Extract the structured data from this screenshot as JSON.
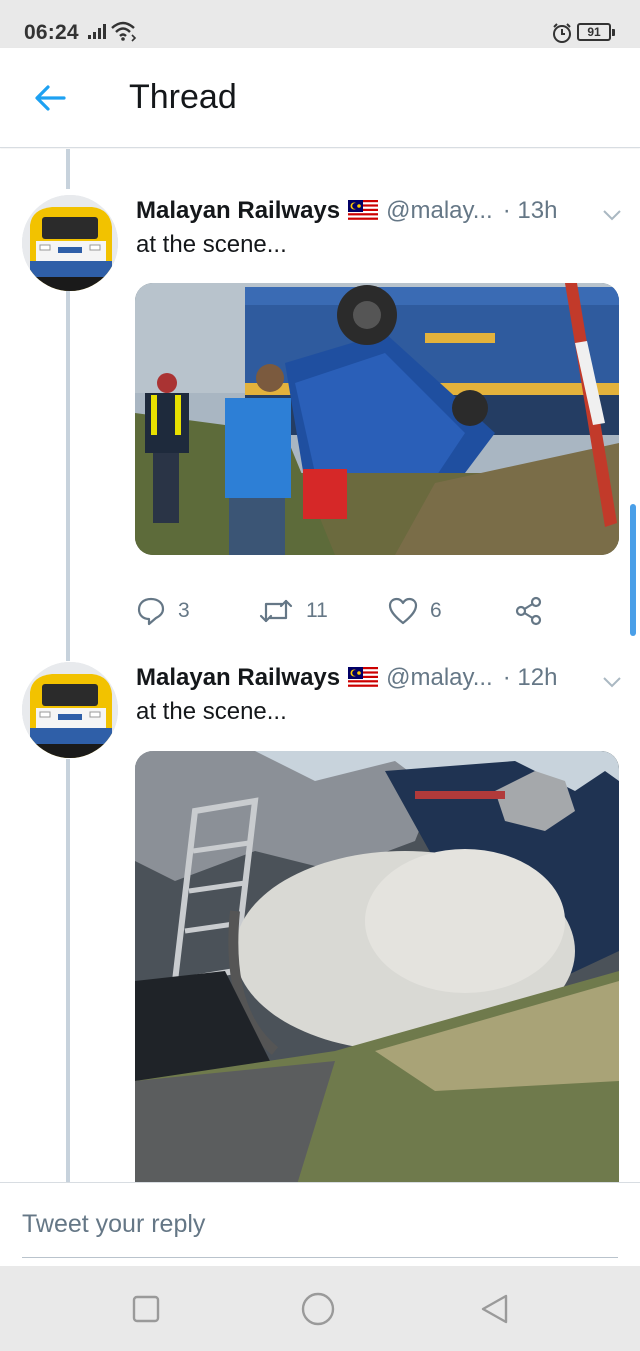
{
  "status_bar": {
    "time": "06:24",
    "battery": "91",
    "icons": [
      "signal-icon",
      "wifi-icon",
      "alarm-icon",
      "battery-icon"
    ]
  },
  "header": {
    "back_icon": "arrow-left-icon",
    "title": "Thread"
  },
  "colors": {
    "accent": "#1da1f2",
    "text_primary": "#14171a",
    "text_secondary": "#657786",
    "thread_line": "#c7d2dc",
    "system_bar": "#e9e9e9",
    "scrollbar": "#4a9fe8"
  },
  "tweets": [
    {
      "author": "Malayan Railways",
      "flag_icon": "malaysia-flag-icon",
      "handle": "@malay...",
      "time": "· 13h",
      "text": "at the scene...",
      "media_description_icon": "photo-overturned-truck",
      "actions": {
        "reply_count": "3",
        "retweet_count": "11",
        "like_count": "6"
      }
    },
    {
      "author": "Malayan Railways",
      "flag_icon": "malaysia-flag-icon",
      "handle": "@malay...",
      "time": "· 12h",
      "text": "at the scene...",
      "media_description_icon": "photo-cement-mixer-drum"
    }
  ],
  "reply": {
    "placeholder": "Tweet your reply"
  },
  "nav": {
    "icons": [
      "recent-apps-icon",
      "home-icon",
      "back-icon"
    ]
  }
}
